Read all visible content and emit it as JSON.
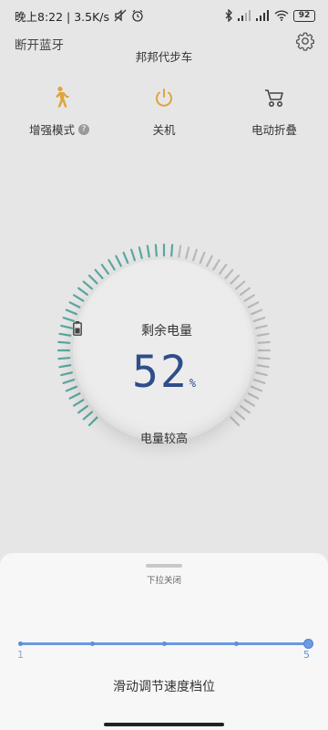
{
  "status_bar": {
    "left_text": "晚上8:22 | 3.5K/s",
    "battery": "92",
    "icons": [
      "mute-icon",
      "alarm-icon",
      "bluetooth-icon",
      "signal-icon",
      "signal-icon",
      "wifi-icon",
      "battery-icon"
    ]
  },
  "header": {
    "bt_disconnect": "断开蓝牙",
    "device_name": "邦邦代步车",
    "settings_icon": "gear-icon"
  },
  "actions": [
    {
      "label": "增强模式",
      "icon": "walking-person-icon",
      "has_help": true
    },
    {
      "label": "关机",
      "icon": "power-icon",
      "has_help": false
    },
    {
      "label": "电动折叠",
      "icon": "folding-cart-icon",
      "has_help": false
    }
  ],
  "gauge": {
    "label": "剩余电量",
    "percent": "52",
    "unit": "%",
    "level_text": "电量较高",
    "value_fraction": 0.52,
    "active_color": "#5aa7a0",
    "inactive_color": "#b9b9b9"
  },
  "sheet": {
    "hint": "下拉关闭",
    "slider_min": "1",
    "slider_max": "5",
    "slider_value": 5,
    "title": "滑动调节速度档位"
  },
  "colors": {
    "accent": "#6b9be0",
    "icon_gold": "#e0a43a",
    "percent_blue": "#2f4d8a"
  }
}
